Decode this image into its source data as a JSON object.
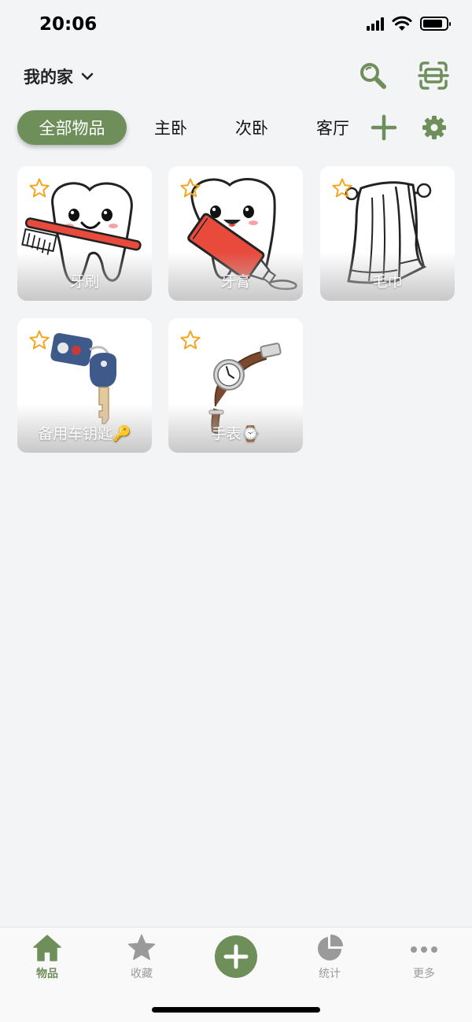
{
  "status_bar": {
    "time": "20:06"
  },
  "header": {
    "home_name": "我的家"
  },
  "tabs": [
    {
      "label": "全部物品",
      "active": true
    },
    {
      "label": "主卧",
      "active": false
    },
    {
      "label": "次卧",
      "active": false
    },
    {
      "label": "客厅",
      "active": false
    }
  ],
  "items": [
    {
      "name": "牙刷",
      "image": "toothbrush-tooth"
    },
    {
      "name": "牙膏",
      "image": "toothpaste-tooth"
    },
    {
      "name": "毛巾",
      "image": "towel"
    },
    {
      "name": "备用车钥匙🔑",
      "image": "car-key"
    },
    {
      "name": "手表⌚",
      "image": "wristwatch"
    }
  ],
  "bottom_nav": {
    "items": [
      {
        "label": "物品",
        "icon": "home-icon",
        "active": true
      },
      {
        "label": "收藏",
        "icon": "star-icon",
        "active": false
      },
      {
        "label": "统计",
        "icon": "pie-chart-icon",
        "active": false
      },
      {
        "label": "更多",
        "icon": "more-icon",
        "active": false
      }
    ]
  },
  "colors": {
    "accent": "#6e8f5a",
    "background": "#f3f4f6",
    "star_outline": "#f2a623"
  }
}
